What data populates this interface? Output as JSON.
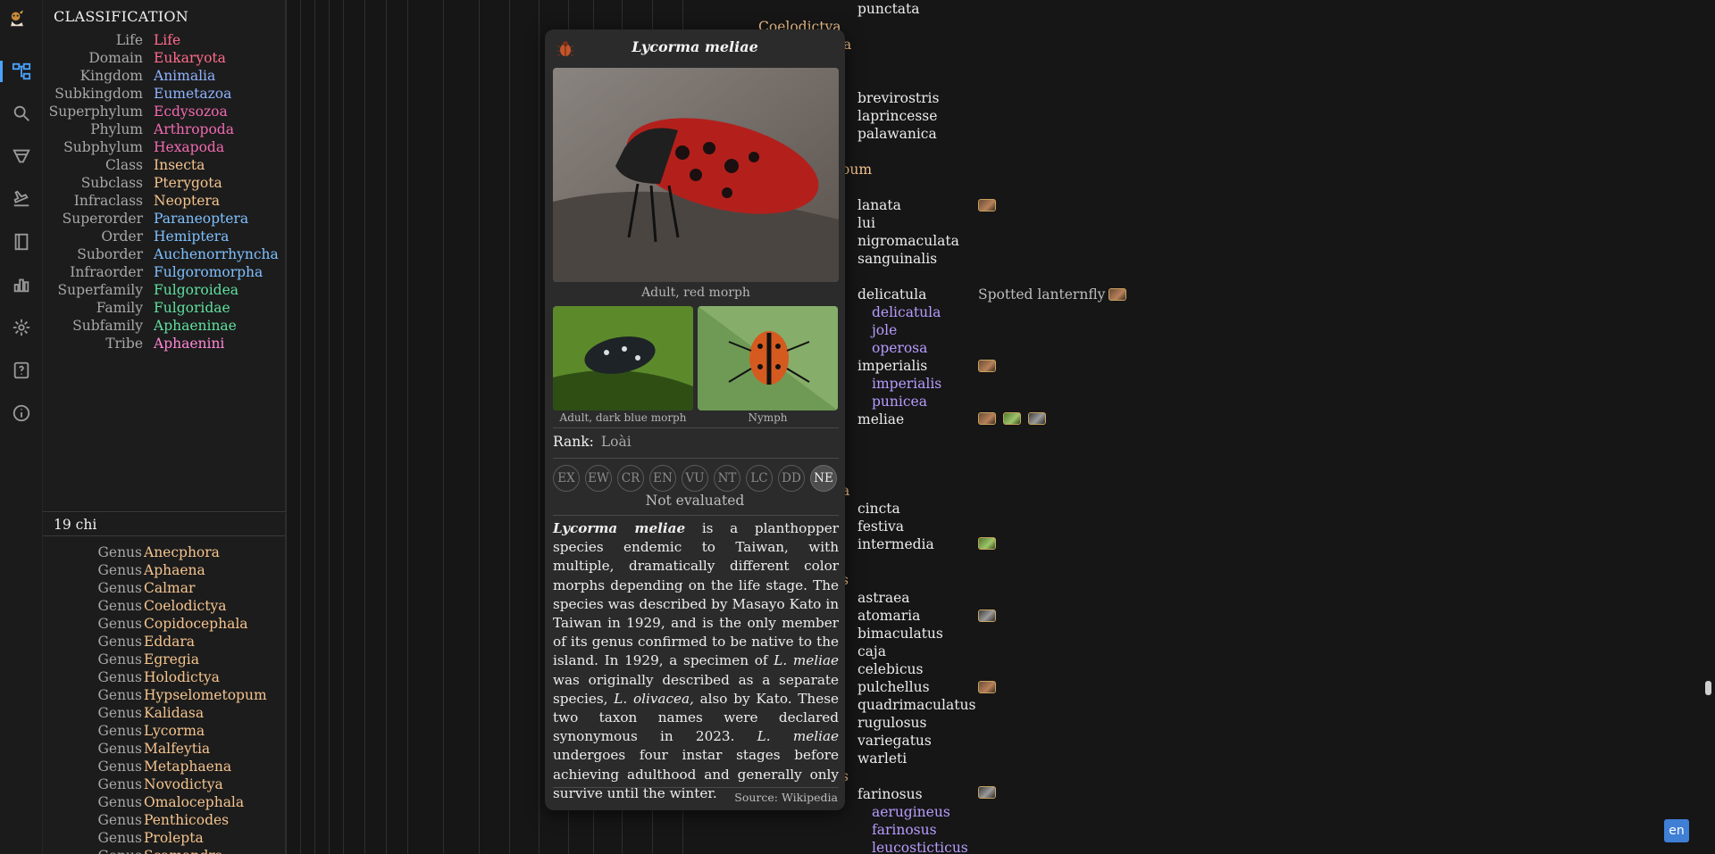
{
  "rail": {
    "icons": [
      "logo-icon",
      "tree-icon",
      "search-icon",
      "filter-icon",
      "flight-icon",
      "book-icon",
      "chart-icon",
      "gear-icon",
      "help-icon",
      "info-icon"
    ]
  },
  "classification": {
    "heading": "CLASSIFICATION",
    "rows": [
      {
        "rank": "Life",
        "name": "Life",
        "color": "#ff6b8a"
      },
      {
        "rank": "Domain",
        "name": "Eukaryota",
        "color": "#ff6b8a"
      },
      {
        "rank": "Kingdom",
        "name": "Animalia",
        "color": "#8fb2ff"
      },
      {
        "rank": "Subkingdom",
        "name": "Eumetazoa",
        "color": "#8fb2ff"
      },
      {
        "rank": "Superphylum",
        "name": "Ecdysozoa",
        "color": "#f06ab0"
      },
      {
        "rank": "Phylum",
        "name": "Arthropoda",
        "color": "#f06ab0"
      },
      {
        "rank": "Subphylum",
        "name": "Hexapoda",
        "color": "#f06ab0"
      },
      {
        "rank": "Class",
        "name": "Insecta",
        "color": "#f5c48e"
      },
      {
        "rank": "Subclass",
        "name": "Pterygota",
        "color": "#f5c48e"
      },
      {
        "rank": "Infraclass",
        "name": "Neoptera",
        "color": "#f5c48e"
      },
      {
        "rank": "Superorder",
        "name": "Paraneoptera",
        "color": "#7fc0ff"
      },
      {
        "rank": "Order",
        "name": "Hemiptera",
        "color": "#7fc0ff"
      },
      {
        "rank": "Suborder",
        "name": "Auchenorrhyncha",
        "color": "#7fc0ff"
      },
      {
        "rank": "Infraorder",
        "name": "Fulgoromorpha",
        "color": "#7fc0ff"
      },
      {
        "rank": "Superfamily",
        "name": "Fulgoroidea",
        "color": "#5fe0a0"
      },
      {
        "rank": "Family",
        "name": "Fulgoridae",
        "color": "#5fe0a0"
      },
      {
        "rank": "Subfamily",
        "name": "Aphaeninae",
        "color": "#5fe0a0"
      },
      {
        "rank": "Tribe",
        "name": "Aphaenini",
        "color": "#ff86d6"
      }
    ]
  },
  "children": {
    "heading": "19 chi",
    "rank_label": "Genus",
    "items": [
      "Anecphora",
      "Aphaena",
      "Calmar",
      "Coelodictya",
      "Copidocephala",
      "Eddara",
      "Egregia",
      "Holodictya",
      "Hypselometopum",
      "Kalidasa",
      "Lycorma",
      "Malfeytia",
      "Metaphaena",
      "Novodictya",
      "Omalocephala",
      "Penthicodes",
      "Prolepta",
      "Scamandra"
    ]
  },
  "tree": {
    "genus_fragments": [
      "Coelodictya",
      "a",
      "oum",
      "a",
      "s",
      "s"
    ],
    "species": [
      {
        "text": "punctata",
        "type": "species"
      },
      {
        "text": "brevirostris",
        "type": "species"
      },
      {
        "text": "laprincesse",
        "type": "species"
      },
      {
        "text": "palawanica",
        "type": "species"
      },
      {
        "text": "lanata",
        "type": "species"
      },
      {
        "text": "lui",
        "type": "species"
      },
      {
        "text": "nigromaculata",
        "type": "species"
      },
      {
        "text": "sanguinalis",
        "type": "species"
      },
      {
        "text": "delicatula",
        "type": "species"
      },
      {
        "text": "delicatula",
        "type": "sub"
      },
      {
        "text": "jole",
        "type": "sub"
      },
      {
        "text": "operosa",
        "type": "sub"
      },
      {
        "text": "imperialis",
        "type": "species"
      },
      {
        "text": "imperialis",
        "type": "sub"
      },
      {
        "text": "punicea",
        "type": "sub"
      },
      {
        "text": "meliae",
        "type": "species"
      },
      {
        "text": "cincta",
        "type": "species"
      },
      {
        "text": "festiva",
        "type": "species"
      },
      {
        "text": "intermedia",
        "type": "species"
      },
      {
        "text": "astraea",
        "type": "species"
      },
      {
        "text": "atomaria",
        "type": "species"
      },
      {
        "text": "bimaculatus",
        "type": "species"
      },
      {
        "text": "caja",
        "type": "species"
      },
      {
        "text": "celebicus",
        "type": "species"
      },
      {
        "text": "pulchellus",
        "type": "species"
      },
      {
        "text": "quadrimaculatus",
        "type": "species"
      },
      {
        "text": "rugulosus",
        "type": "species"
      },
      {
        "text": "variegatus",
        "type": "species"
      },
      {
        "text": "warleti",
        "type": "species"
      },
      {
        "text": "farinosus",
        "type": "species"
      },
      {
        "text": "aerugineus",
        "type": "sub"
      },
      {
        "text": "farinosus",
        "type": "sub"
      },
      {
        "text": "leucosticticus",
        "type": "sub"
      }
    ],
    "common_name": "Spotted lanternfly"
  },
  "card": {
    "title": "Lycorma meliae",
    "main_caption": "Adult, red morph",
    "small_captions": [
      "Adult, dark blue morph",
      "Nymph"
    ],
    "rank_key": "Rank:",
    "rank_value": "Loài",
    "iucn": [
      "EX",
      "EW",
      "CR",
      "EN",
      "VU",
      "NT",
      "LC",
      "DD",
      "NE"
    ],
    "iucn_active": "NE",
    "status": "Not evaluated",
    "source": "Source: Wikipedia",
    "description": {
      "p0b": "Lycorma meliae",
      "p1": " is a planthopper species endemic to Taiwan, with multiple, dramatically different color morphs depending on the life stage. The species was described by Masayo Kato in Taiwan in 1929, and is the only member of its genus confirmed to be native to the island. In 1929, a specimen of ",
      "p2i": "L. meliae",
      "p3": " was originally described as a separate species, ",
      "p4i": "L. olivacea,",
      "p5": " also by Kato. These two taxon names were declared synonymous in 2023. ",
      "p6i": "L. meliae",
      "p7": " undergoes four instar stages before achieving adulthood and generally only survive until the winter."
    }
  },
  "lang": "en"
}
